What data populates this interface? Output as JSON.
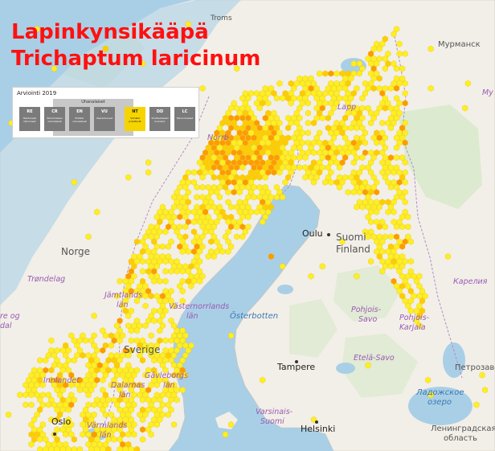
{
  "title": {
    "common_name": "Lapinkynsikääpä",
    "scientific_name": "Trichaptum laricinum"
  },
  "status_panel": {
    "heading": "Arviointi 2019",
    "threatened_label": "Uhanalaiset",
    "categories": [
      {
        "abbr": "RE",
        "desc": "Hävinneet/ hävinneet",
        "active": false
      },
      {
        "abbr": "CR",
        "desc": "Äärimmäisen uhanalaiset",
        "active": false
      },
      {
        "abbr": "EN",
        "desc": "Erittäin uhanalaiset",
        "active": false
      },
      {
        "abbr": "VU",
        "desc": "Vaarantuneet",
        "active": false
      },
      {
        "abbr": "NT",
        "desc": "Silmällä pidettävät",
        "active": true
      },
      {
        "abbr": "DD",
        "desc": "Puutteellisesti tunnetut",
        "active": false
      },
      {
        "abbr": "LC",
        "desc": "Elinvoimaiset",
        "active": false
      }
    ]
  },
  "labels": {
    "troms": "Troms",
    "murmansk": "Мурманск",
    "lapp": "Lapp",
    "norrbotten": "Norrb",
    "oulu": "Oulu",
    "suomi": "Suomi",
    "finland": "Finland",
    "norge": "Norge",
    "trondelag": "Trøndelag",
    "more_og": "re og",
    "dal": "dal",
    "jamtlands": "Jämtlands",
    "jamtlands_lan": "län",
    "vasternorrlands": "Västernorrlands",
    "vasternorrlands_lan": "län",
    "sverige": "Sverige",
    "osterbotten": "Österbotten",
    "pohjois_savo_1": "Pohjois-",
    "pohjois_savo_2": "Savo",
    "pohjois_karjala_1": "Pohjois-",
    "pohjois_karjala_2": "Karjala",
    "karelia": "Карелия",
    "tampere": "Tampere",
    "etela_savo": "Etelä-Savo",
    "petrozavodsk": "Петрозаводск",
    "lake_ladoga_1": "Ладожское",
    "lake_ladoga_2": "озеро",
    "innlandet": "Innlandet",
    "gavleborgs_1": "Gävleborgs",
    "gavleborgs_2": "län",
    "dalarnas_1": "Dalarnas",
    "dalarnas_2": "län",
    "varsinais_1": "Varsinais-",
    "varsinais_2": "Suomi",
    "helsinki": "Helsinki",
    "oslo": "Oslo",
    "varmlands_1": "Värmlands",
    "varmlands_2": "län",
    "leningrad_1": "Ленинградская",
    "leningrad_2": "область",
    "right_edge": "Му"
  },
  "colors": {
    "sea": "#a9cfe6",
    "land": "#f2efe8",
    "forest": "#d6e8c8",
    "hex_light": "#ffee22",
    "hex_mid": "#ffcc00",
    "hex_dark": "#ff9a00",
    "title": "#ff1010",
    "active_category": "#f6d400"
  }
}
